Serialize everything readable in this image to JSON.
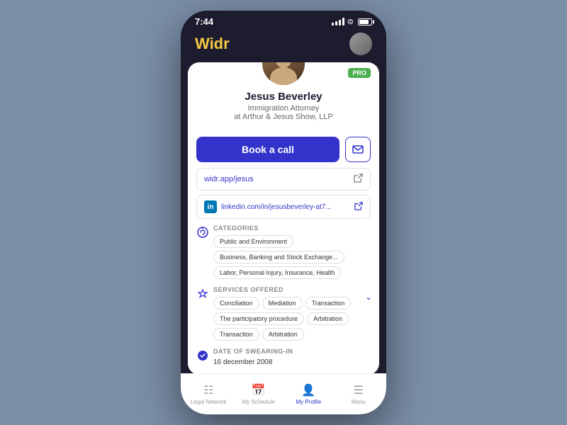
{
  "statusBar": {
    "time": "7:44"
  },
  "header": {
    "appTitle": "Widr"
  },
  "profile": {
    "name": "Jesus Beverley",
    "title": "Immigration Attorney",
    "company": "at  Arthur & Jesus Show, LLP",
    "proBadge": "PRO",
    "profileUrl": "widr.app/jesus",
    "linkedinUrl": "linkedin.com/in/jesusbeverley-at7...",
    "bookCallLabel": "Book a call"
  },
  "categories": {
    "sectionTitle": "CATEGORIES",
    "tags": [
      "Public and Environment",
      "Business, Banking and Stock Exchange...",
      "Labor, Personal Injury, Insurance, Health"
    ]
  },
  "services": {
    "sectionTitle": "SERVICES OFFERED",
    "tags": [
      "Conciliation",
      "Mediation",
      "Transaction",
      "The participatory procedure",
      "Arbitration",
      "Transaction",
      "Arbitration"
    ]
  },
  "swearing": {
    "sectionTitle": "DATE OF SWEARING-IN",
    "date": "16 december 2008"
  },
  "bottomNav": {
    "items": [
      {
        "label": "Legal Network",
        "icon": "⊞"
      },
      {
        "label": "My Schedule",
        "icon": "📅"
      },
      {
        "label": "My Profile",
        "icon": "👤",
        "active": true
      },
      {
        "label": "Menu",
        "icon": "☰"
      }
    ]
  }
}
